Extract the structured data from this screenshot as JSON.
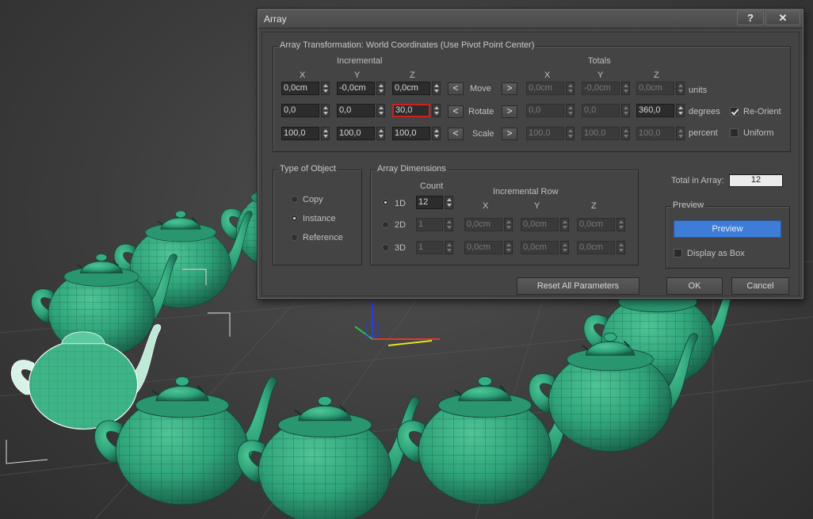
{
  "dialog": {
    "title": "Array",
    "help_label": "?",
    "close_label": "✕"
  },
  "transformation": {
    "group_label": "Array Transformation: World Coordinates (Use Pivot Point Center)",
    "incremental_label": "Incremental",
    "totals_label": "Totals",
    "axes": [
      "X",
      "Y",
      "Z"
    ],
    "rows": [
      {
        "name": "move",
        "label": "Move",
        "incremental": [
          "0,0cm",
          "-0,0cm",
          "0,0cm"
        ],
        "totals": [
          "0,0cm",
          "-0,0cm",
          "0,0cm"
        ],
        "unit": "units"
      },
      {
        "name": "rotate",
        "label": "Rotate",
        "incremental": [
          "0,0",
          "0,0",
          "30,0"
        ],
        "totals": [
          "0,0",
          "0,0",
          "360,0"
        ],
        "unit": "degrees"
      },
      {
        "name": "scale",
        "label": "Scale",
        "incremental": [
          "100,0",
          "100,0",
          "100,0"
        ],
        "totals": [
          "100,0",
          "100,0",
          "100,0"
        ],
        "unit": "percent"
      }
    ],
    "left_arrow": "<",
    "right_arrow": ">",
    "reorient_label": "Re-Orient",
    "reorient_checked": true,
    "uniform_label": "Uniform",
    "uniform_checked": false
  },
  "type_of_object": {
    "group_label": "Type of Object",
    "options": [
      "Copy",
      "Instance",
      "Reference"
    ],
    "selected": "Instance"
  },
  "dimensions": {
    "group_label": "Array Dimensions",
    "count_label": "Count",
    "incremental_row_label": "Incremental Row",
    "axes": [
      "X",
      "Y",
      "Z"
    ],
    "rows": [
      {
        "label": "1D",
        "count": "12",
        "values": []
      },
      {
        "label": "2D",
        "count": "1",
        "values": [
          "0,0cm",
          "0,0cm",
          "0,0cm"
        ]
      },
      {
        "label": "3D",
        "count": "1",
        "values": [
          "0,0cm",
          "0,0cm",
          "0,0cm"
        ]
      }
    ],
    "selected": "1D"
  },
  "total": {
    "label": "Total in Array:",
    "value": "12"
  },
  "preview": {
    "group_label": "Preview",
    "button_label": "Preview",
    "display_as_box_label": "Display as Box",
    "display_as_box_checked": false
  },
  "buttons": {
    "reset": "Reset All Parameters",
    "ok": "OK",
    "cancel": "Cancel"
  },
  "colors": {
    "teapot": "#2fa47a",
    "teapot_dark": "#16604a",
    "selection": "#ffffff",
    "highlight": "#d11f1f",
    "preview_button": "#3d7dd8"
  }
}
